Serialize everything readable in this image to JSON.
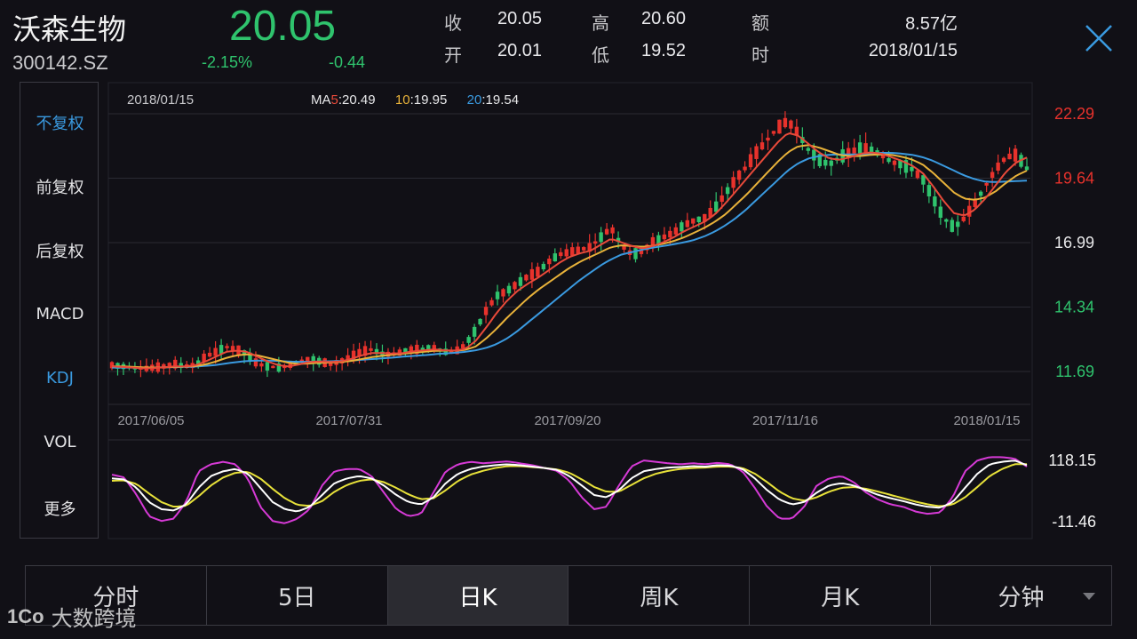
{
  "header": {
    "name": "沃森生物",
    "code": "300142.SZ",
    "price": "20.05",
    "change_pct": "-2.15%",
    "change_amt": "-0.44",
    "quote": [
      {
        "label": "收",
        "value": "20.05"
      },
      {
        "label": "高",
        "value": "20.60"
      },
      {
        "label": "额",
        "value": "8.57亿"
      },
      {
        "label": "开",
        "value": "20.01"
      },
      {
        "label": "低",
        "value": "19.52"
      },
      {
        "label": "时",
        "value": "2018/01/15"
      }
    ]
  },
  "adjust_panel": {
    "items": [
      "不复权",
      "前复权",
      "后复权",
      "MACD",
      "KDJ",
      "VOL",
      "更多"
    ],
    "active": [
      "不复权",
      "KDJ"
    ]
  },
  "ma_legend": {
    "date": "2018/01/15",
    "ma5_prefix": "MA",
    "ma5_num": "5",
    "ma5_value": ":20.49",
    "ma10_num": "10",
    "ma10_value": ":19.95",
    "ma20_num": "20",
    "ma20_value": ":19.54"
  },
  "chart_data": [
    {
      "type": "candlestick",
      "title": "",
      "x_ticks": [
        "2017/06/05",
        "2017/07/31",
        "2017/09/20",
        "2017/11/16",
        "2018/01/15"
      ],
      "y_ticks": [
        "22.29",
        "19.64",
        "16.99",
        "14.34",
        "11.69"
      ],
      "ylim": [
        11.69,
        22.29
      ],
      "grid": true,
      "series": [
        {
          "name": "MA5",
          "color": "#e84a3a",
          "last": 20.49
        },
        {
          "name": "MA10",
          "color": "#e8b23a",
          "last": 19.95
        },
        {
          "name": "MA20",
          "color": "#3a9ae0",
          "last": 19.54
        }
      ],
      "price_path": [
        11.95,
        11.9,
        11.85,
        11.8,
        11.85,
        11.9,
        12.0,
        11.9,
        11.95,
        12.3,
        12.5,
        12.7,
        12.6,
        12.4,
        12.0,
        11.9,
        11.85,
        11.9,
        12.1,
        12.2,
        12.1,
        12.0,
        12.1,
        12.3,
        12.5,
        12.6,
        12.4,
        12.4,
        12.5,
        12.6,
        12.6,
        12.7,
        12.5,
        12.5,
        12.8,
        13.4,
        14.2,
        14.8,
        15.0,
        15.3,
        15.6,
        15.8,
        16.2,
        16.5,
        16.6,
        16.7,
        16.8,
        17.2,
        17.6,
        16.9,
        16.5,
        16.6,
        17.0,
        17.2,
        17.4,
        17.7,
        17.9,
        18.0,
        18.4,
        19.0,
        19.6,
        20.1,
        20.7,
        21.2,
        21.7,
        22.0,
        21.5,
        20.8,
        20.4,
        20.2,
        20.5,
        20.7,
        20.9,
        20.8,
        20.6,
        20.3,
        20.2,
        20.0,
        19.6,
        18.8,
        18.0,
        17.6,
        18.0,
        18.6,
        19.3,
        20.0,
        20.5,
        20.6,
        20.05
      ],
      "ma5_path": [
        11.9,
        11.88,
        11.85,
        11.82,
        11.83,
        11.86,
        11.9,
        11.9,
        11.94,
        12.1,
        12.3,
        12.5,
        12.55,
        12.5,
        12.3,
        12.1,
        11.95,
        11.9,
        11.98,
        12.08,
        12.1,
        12.08,
        12.1,
        12.2,
        12.35,
        12.45,
        12.45,
        12.42,
        12.45,
        12.52,
        12.56,
        12.6,
        12.56,
        12.55,
        12.62,
        12.95,
        13.5,
        14.1,
        14.6,
        15.0,
        15.3,
        15.55,
        15.85,
        16.15,
        16.4,
        16.55,
        16.65,
        16.9,
        17.15,
        17.0,
        16.85,
        16.75,
        16.85,
        17.0,
        17.2,
        17.45,
        17.65,
        17.85,
        18.15,
        18.6,
        19.1,
        19.6,
        20.1,
        20.6,
        21.1,
        21.5,
        21.4,
        21.05,
        20.7,
        20.45,
        20.4,
        20.5,
        20.65,
        20.7,
        20.65,
        20.5,
        20.35,
        20.15,
        19.85,
        19.3,
        18.7,
        18.2,
        18.1,
        18.35,
        18.8,
        19.35,
        19.9,
        20.3,
        20.49
      ],
      "ma10_path": [
        11.9,
        11.9,
        11.88,
        11.86,
        11.85,
        11.86,
        11.88,
        11.89,
        11.91,
        11.98,
        12.1,
        12.25,
        12.35,
        12.4,
        12.35,
        12.25,
        12.15,
        12.05,
        12.0,
        12.02,
        12.05,
        12.06,
        12.08,
        12.12,
        12.2,
        12.28,
        12.34,
        12.38,
        12.42,
        12.46,
        12.5,
        12.54,
        12.55,
        12.55,
        12.58,
        12.72,
        13.05,
        13.45,
        13.9,
        14.3,
        14.7,
        15.05,
        15.35,
        15.65,
        15.95,
        16.2,
        16.4,
        16.6,
        16.8,
        16.88,
        16.85,
        16.82,
        16.86,
        16.94,
        17.05,
        17.2,
        17.4,
        17.6,
        17.85,
        18.15,
        18.55,
        18.95,
        19.4,
        19.85,
        20.3,
        20.7,
        20.95,
        21.0,
        20.9,
        20.75,
        20.6,
        20.55,
        20.55,
        20.6,
        20.62,
        20.6,
        20.52,
        20.4,
        20.2,
        19.85,
        19.45,
        19.05,
        18.8,
        18.75,
        18.85,
        19.1,
        19.45,
        19.75,
        19.95
      ],
      "ma20_path": [
        11.85,
        11.85,
        11.85,
        11.85,
        11.85,
        11.86,
        11.87,
        11.88,
        11.89,
        11.92,
        11.96,
        12.02,
        12.08,
        12.12,
        12.14,
        12.14,
        12.12,
        12.1,
        12.09,
        12.09,
        12.1,
        12.11,
        12.12,
        12.14,
        12.17,
        12.2,
        12.23,
        12.26,
        12.3,
        12.33,
        12.36,
        12.4,
        12.43,
        12.46,
        12.5,
        12.56,
        12.66,
        12.82,
        13.05,
        13.35,
        13.7,
        14.05,
        14.4,
        14.75,
        15.1,
        15.45,
        15.75,
        16.05,
        16.3,
        16.5,
        16.6,
        16.7,
        16.78,
        16.85,
        16.92,
        17.0,
        17.1,
        17.25,
        17.45,
        17.7,
        18.0,
        18.35,
        18.75,
        19.15,
        19.55,
        19.95,
        20.25,
        20.45,
        20.55,
        20.6,
        20.62,
        20.62,
        20.62,
        20.65,
        20.68,
        20.68,
        20.65,
        20.6,
        20.5,
        20.35,
        20.15,
        19.95,
        19.75,
        19.6,
        19.5,
        19.48,
        19.5,
        19.52,
        19.54
      ]
    },
    {
      "type": "line",
      "title": "KDJ",
      "y_ticks": [
        "118.15",
        "-11.46"
      ],
      "ylim": [
        -11.46,
        118.15
      ],
      "series": [
        {
          "name": "K",
          "color": "#ffffff"
        },
        {
          "name": "D",
          "color": "#e8e23a"
        },
        {
          "name": "J",
          "color": "#d63ad6"
        }
      ],
      "k_path": [
        80,
        78,
        60,
        30,
        15,
        12,
        25,
        60,
        85,
        95,
        100,
        90,
        60,
        30,
        15,
        10,
        20,
        45,
        70,
        80,
        85,
        80,
        65,
        45,
        30,
        25,
        40,
        70,
        90,
        100,
        105,
        108,
        110,
        108,
        105,
        102,
        98,
        85,
        65,
        45,
        40,
        55,
        80,
        95,
        100,
        103,
        104,
        106,
        105,
        108,
        107,
        100,
        80,
        55,
        35,
        25,
        30,
        50,
        65,
        70,
        65,
        55,
        45,
        38,
        32,
        25,
        20,
        18,
        30,
        60,
        90,
        110,
        115,
        118,
        108
      ],
      "d_path": [
        75,
        76,
        68,
        48,
        30,
        20,
        22,
        42,
        65,
        82,
        92,
        94,
        80,
        58,
        38,
        24,
        22,
        32,
        52,
        66,
        75,
        78,
        72,
        60,
        46,
        36,
        38,
        55,
        75,
        88,
        96,
        102,
        106,
        106,
        104,
        102,
        99,
        92,
        78,
        62,
        52,
        52,
        66,
        80,
        90,
        96,
        100,
        102,
        103,
        105,
        105,
        102,
        90,
        72,
        52,
        38,
        33,
        40,
        52,
        60,
        62,
        58,
        52,
        45,
        38,
        31,
        25,
        21,
        25,
        40,
        62,
        85,
        100,
        110,
        110
      ],
      "j_path": [
        88,
        82,
        45,
        0,
        -10,
        -5,
        30,
        95,
        110,
        115,
        110,
        80,
        20,
        -10,
        -15,
        -5,
        15,
        65,
        95,
        100,
        100,
        85,
        50,
        15,
        0,
        5,
        50,
        95,
        110,
        115,
        112,
        114,
        116,
        112,
        108,
        102,
        96,
        75,
        40,
        15,
        20,
        65,
        105,
        118,
        115,
        112,
        110,
        112,
        110,
        113,
        110,
        95,
        60,
        20,
        -5,
        -5,
        20,
        65,
        80,
        85,
        72,
        50,
        35,
        25,
        20,
        10,
        5,
        8,
        40,
        95,
        118,
        125,
        125,
        122,
        105
      ]
    }
  ],
  "period_tabs": [
    "分时",
    "5日",
    "日K",
    "周K",
    "月K",
    "分钟"
  ],
  "active_tab": "日K",
  "watermark": {
    "logo": "1Co",
    "text": "大数跨境"
  },
  "colors": {
    "up": "#e8322c",
    "down": "#2fc36d",
    "accent": "#3a9ae0",
    "grid": "#2a2a33"
  }
}
